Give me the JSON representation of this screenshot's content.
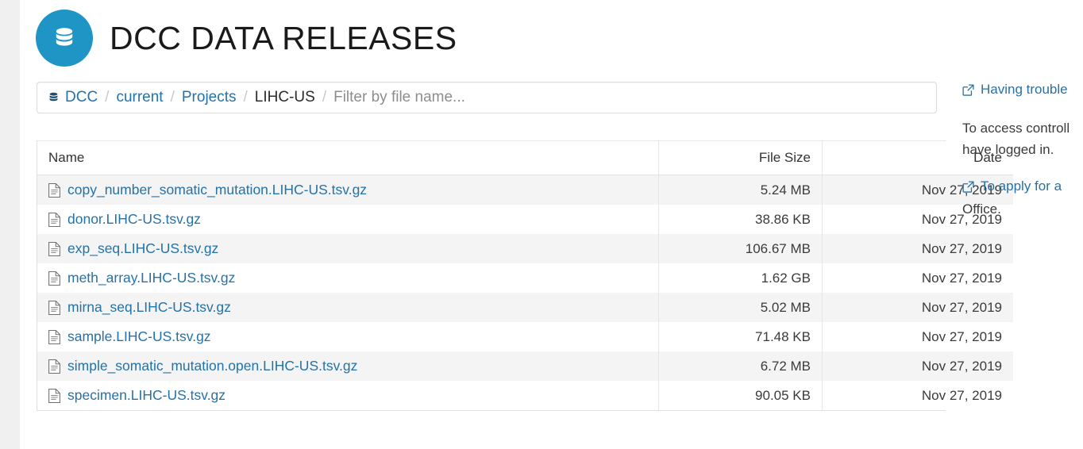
{
  "header": {
    "title": "DCC DATA RELEASES",
    "logo_icon": "database-icon",
    "logo_color": "#1f95c6"
  },
  "breadcrumb": {
    "db_icon": "database-icon",
    "separator": "/",
    "items": [
      {
        "label": "DCC",
        "current": false
      },
      {
        "label": "current",
        "current": false
      },
      {
        "label": "Projects",
        "current": false
      },
      {
        "label": "LIHC-US",
        "current": true
      }
    ],
    "filter": {
      "value": "",
      "placeholder": "Filter by file name..."
    },
    "link_color": "#2572a8"
  },
  "table": {
    "columns": [
      {
        "key": "name",
        "label": "Name",
        "align": "left"
      },
      {
        "key": "size",
        "label": "File Size",
        "align": "right"
      },
      {
        "key": "date",
        "label": "Date",
        "align": "right"
      }
    ],
    "rows": [
      {
        "icon": "file-icon",
        "name": "copy_number_somatic_mutation.LIHC-US.tsv.gz",
        "size": "5.24 MB",
        "date": "Nov 27, 2019"
      },
      {
        "icon": "file-icon",
        "name": "donor.LIHC-US.tsv.gz",
        "size": "38.86 KB",
        "date": "Nov 27, 2019"
      },
      {
        "icon": "file-icon",
        "name": "exp_seq.LIHC-US.tsv.gz",
        "size": "106.67 MB",
        "date": "Nov 27, 2019"
      },
      {
        "icon": "file-icon",
        "name": "meth_array.LIHC-US.tsv.gz",
        "size": "1.62 GB",
        "date": "Nov 27, 2019"
      },
      {
        "icon": "file-icon",
        "name": "mirna_seq.LIHC-US.tsv.gz",
        "size": "5.02 MB",
        "date": "Nov 27, 2019"
      },
      {
        "icon": "file-icon",
        "name": "sample.LIHC-US.tsv.gz",
        "size": "71.48 KB",
        "date": "Nov 27, 2019"
      },
      {
        "icon": "file-icon",
        "name": "simple_somatic_mutation.open.LIHC-US.tsv.gz",
        "size": "6.72 MB",
        "date": "Nov 27, 2019"
      },
      {
        "icon": "file-icon",
        "name": "specimen.LIHC-US.tsv.gz",
        "size": "90.05 KB",
        "date": "Nov 27, 2019"
      }
    ]
  },
  "help": {
    "trouble_link": "Having trouble",
    "access_text_line1": "To access controll",
    "access_text_line2": "have logged in.",
    "apply_link": "To apply for a",
    "apply_text_line2": "Office."
  }
}
